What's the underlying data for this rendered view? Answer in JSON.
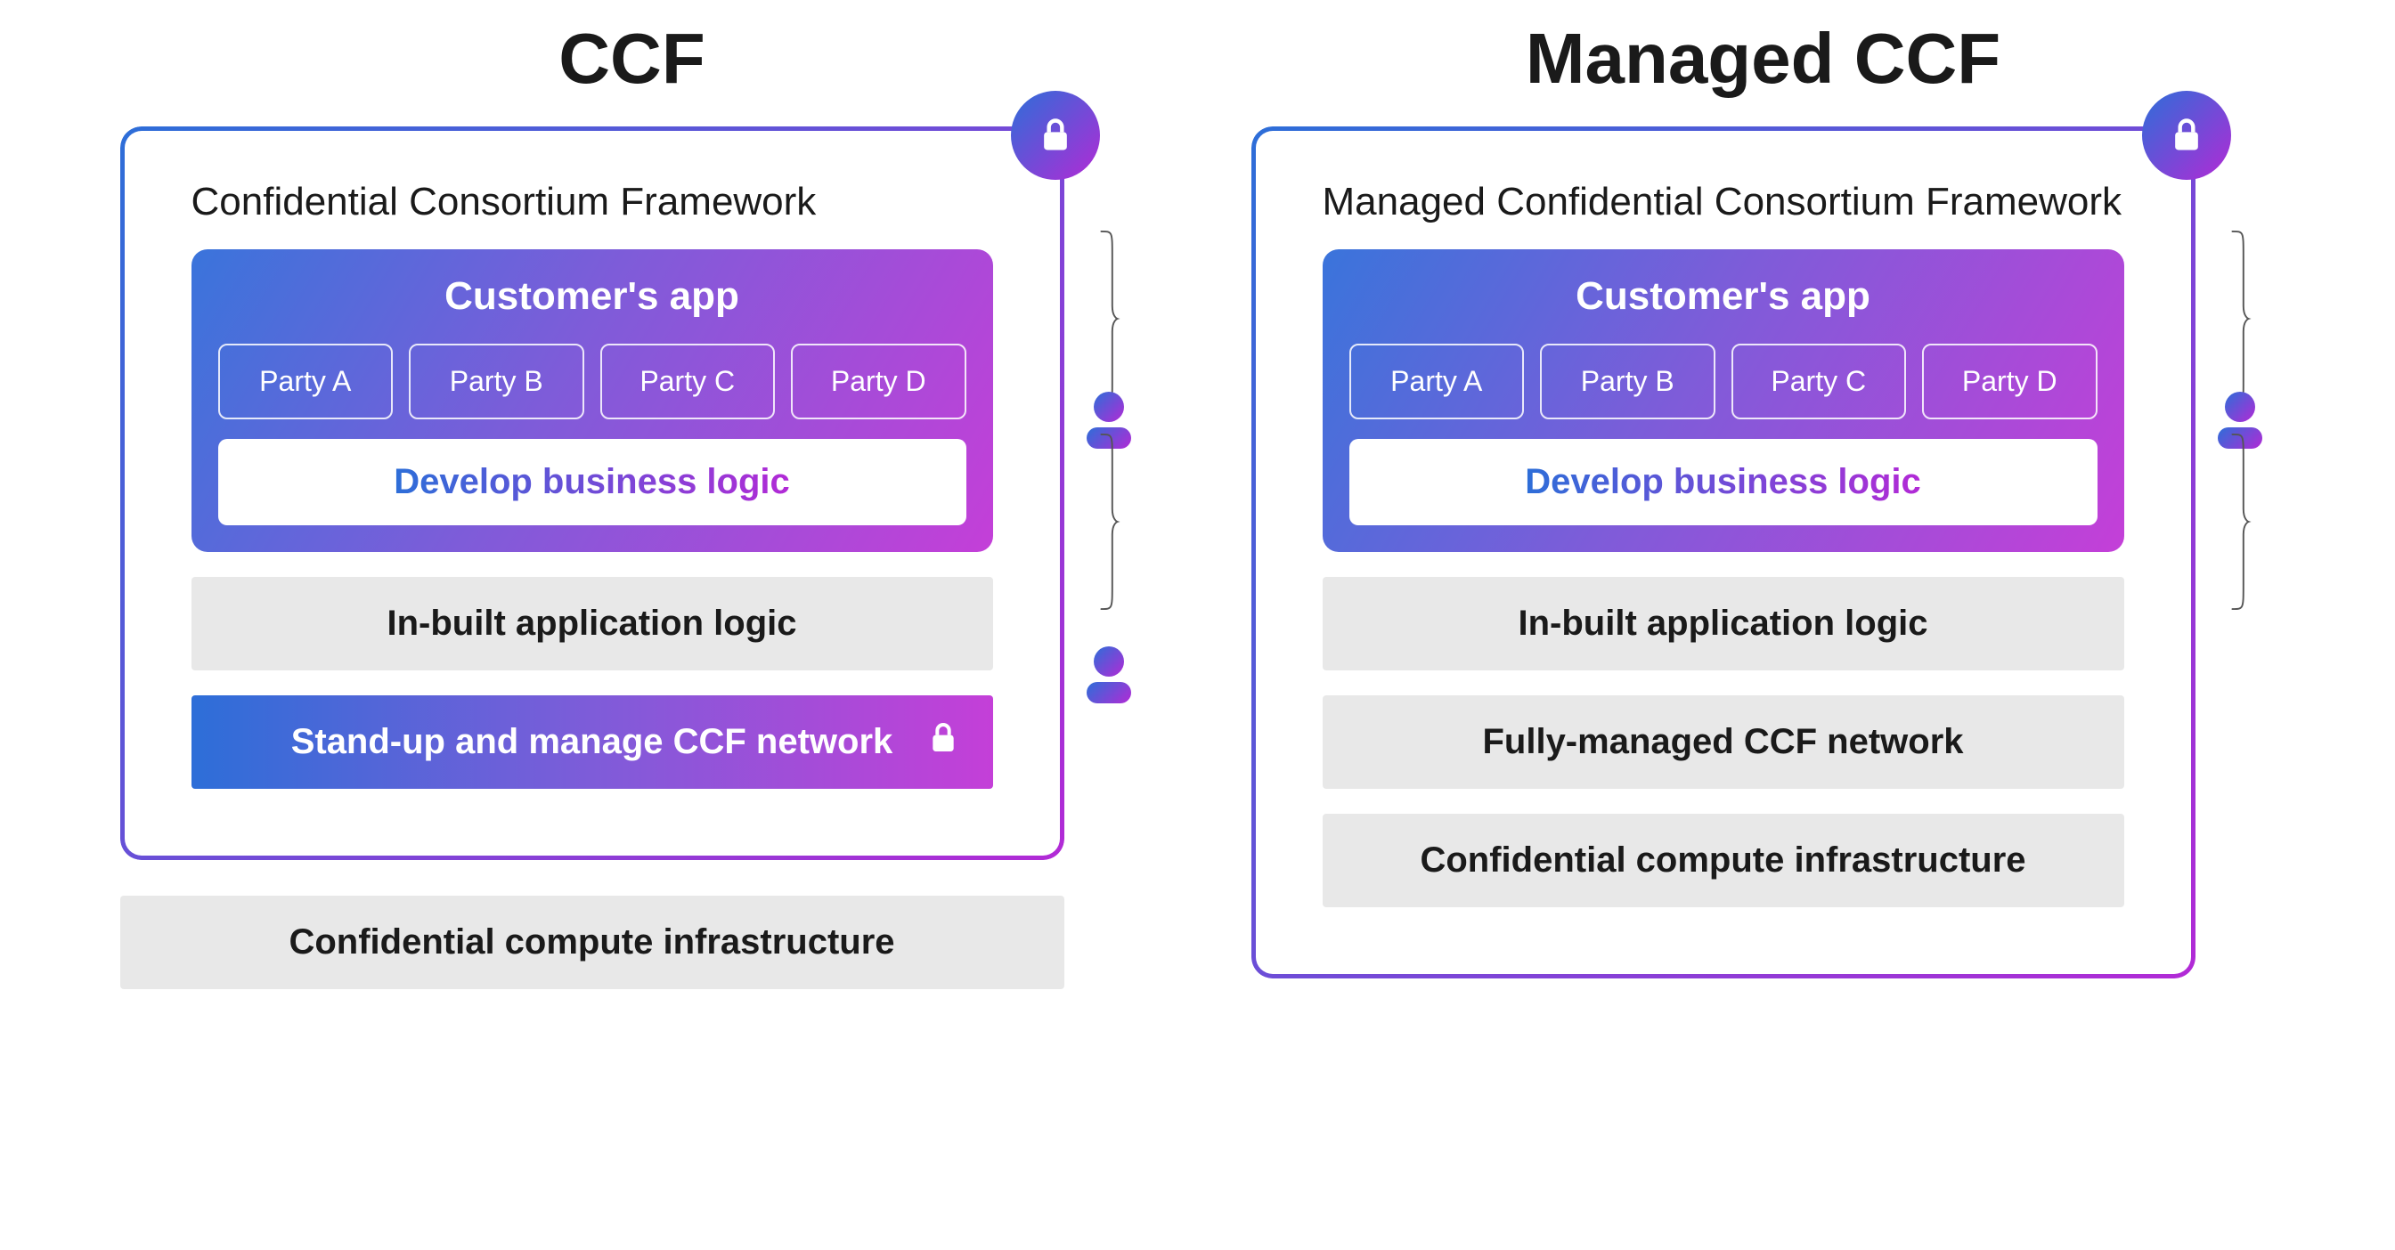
{
  "left": {
    "title": "CCF",
    "frameworkHeader": "Confidential Consortium Framework",
    "app": {
      "title": "Customer's app",
      "parties": [
        "Party A",
        "Party B",
        "Party C",
        "Party D"
      ],
      "develop": "Develop business logic"
    },
    "inbuilt": "In-built application logic",
    "manage": "Stand-up and manage CCF network",
    "outside": "Confidential compute infrastructure"
  },
  "right": {
    "title": "Managed CCF",
    "frameworkHeader": "Managed Confidential Consortium Framework",
    "app": {
      "title": "Customer's app",
      "parties": [
        "Party A",
        "Party B",
        "Party C",
        "Party D"
      ],
      "develop": "Develop business logic"
    },
    "inbuilt": "In-built application logic",
    "manage": "Fully-managed CCF network",
    "outside": "Confidential compute infrastructure"
  }
}
